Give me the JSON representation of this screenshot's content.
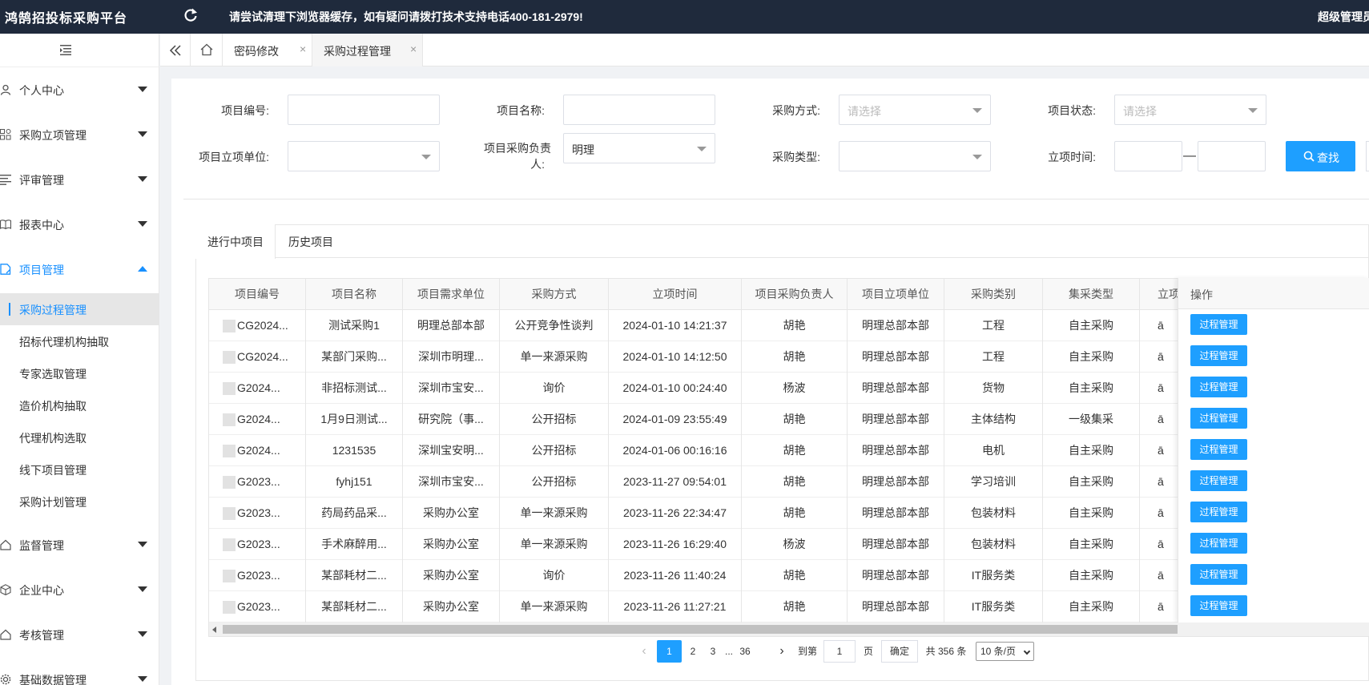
{
  "header": {
    "logo": "鸿鹄招投标采购平台",
    "notice": "请尝试清理下浏览器缓存，如有疑问请拨打技术支持电话400-181-2979!",
    "user": "超级管理员"
  },
  "sidebar": {
    "groups": [
      {
        "label": "个人中心",
        "icon": "user-icon"
      },
      {
        "label": "采购立项管理",
        "icon": "grid-icon"
      },
      {
        "label": "评审管理",
        "icon": "list-icon"
      },
      {
        "label": "报表中心",
        "icon": "book-icon"
      },
      {
        "label": "项目管理",
        "icon": "file-icon",
        "open": true
      },
      {
        "label": "监督管理",
        "icon": "home-icon"
      },
      {
        "label": "企业中心",
        "icon": "cube-icon"
      },
      {
        "label": "考核管理",
        "icon": "home-icon"
      },
      {
        "label": "基础数据管理",
        "icon": "gear-icon"
      }
    ],
    "sub_items": [
      {
        "label": "采购过程管理",
        "active": true
      },
      {
        "label": "招标代理机构抽取"
      },
      {
        "label": "专家选取管理"
      },
      {
        "label": "造价机构抽取"
      },
      {
        "label": "代理机构选取"
      },
      {
        "label": "线下项目管理"
      },
      {
        "label": "采购计划管理"
      }
    ]
  },
  "tabs": [
    {
      "label": "密码修改",
      "close": "×"
    },
    {
      "label": "采购过程管理",
      "close": "×",
      "active": true
    }
  ],
  "filters": {
    "project_code_label": "项目编号:",
    "project_name_label": "项目名称:",
    "purchase_method_label": "采购方式:",
    "purchase_method_placeholder": "请选择",
    "project_status_label": "项目状态:",
    "project_status_placeholder": "请选择",
    "project_unit_label": "项目立项单位:",
    "manager_label_line1": "项目采购负责",
    "manager_label_line2": "人:",
    "manager_value": "明理",
    "purchase_type_label": "采购类型:",
    "date_label": "立项时间:",
    "date_dash": "—",
    "search_button": "查找"
  },
  "panel_tabs": [
    "进行中项目",
    "历史项目"
  ],
  "table": {
    "columns": [
      "项目编号",
      "项目名称",
      "项目需求单位",
      "采购方式",
      "立项时间",
      "项目采购负责人",
      "项目立项单位",
      "采购类别",
      "集采类型",
      "立项"
    ],
    "op_header": "操作",
    "op_button": "过程管理",
    "rows": [
      {
        "code": "CG2024...",
        "name": "测试采购1",
        "unit": "明理总部本部",
        "method": "公开竞争性谈判",
        "time": "2024-01-10 14:21:37",
        "manager": "胡艳",
        "org": "明理总部本部",
        "category": "工程",
        "collect": "自主采购",
        "status": "ā"
      },
      {
        "code": "CG2024...",
        "name": "某部门采购...",
        "unit": "深圳市明理...",
        "method": "单一来源采购",
        "time": "2024-01-10 14:12:50",
        "manager": "胡艳",
        "org": "明理总部本部",
        "category": "工程",
        "collect": "自主采购",
        "status": "ā"
      },
      {
        "code": "G2024...",
        "name": "非招标测试...",
        "unit": "深圳市宝安...",
        "method": "询价",
        "time": "2024-01-10 00:24:40",
        "manager": "杨波",
        "org": "明理总部本部",
        "category": "货物",
        "collect": "自主采购",
        "status": "ā"
      },
      {
        "code": "G2024...",
        "name": "1月9日测试...",
        "unit": "研究院（事...",
        "method": "公开招标",
        "time": "2024-01-09 23:55:49",
        "manager": "胡艳",
        "org": "明理总部本部",
        "category": "主体结构",
        "collect": "一级集采",
        "status": "ā"
      },
      {
        "code": "G2024...",
        "name": "1231535",
        "unit": "深圳宝安明...",
        "method": "公开招标",
        "time": "2024-01-06 00:16:16",
        "manager": "胡艳",
        "org": "明理总部本部",
        "category": "电机",
        "collect": "自主采购",
        "status": "ā"
      },
      {
        "code": "G2023...",
        "name": "fyhj151",
        "unit": "深圳市宝安...",
        "method": "公开招标",
        "time": "2023-11-27 09:54:01",
        "manager": "胡艳",
        "org": "明理总部本部",
        "category": "学习培训",
        "collect": "自主采购",
        "status": "ā"
      },
      {
        "code": "G2023...",
        "name": "药局药品采...",
        "unit": "采购办公室",
        "method": "单一来源采购",
        "time": "2023-11-26 22:34:47",
        "manager": "胡艳",
        "org": "明理总部本部",
        "category": "包装材料",
        "collect": "自主采购",
        "status": "ā"
      },
      {
        "code": "G2023...",
        "name": "手术麻醉用...",
        "unit": "采购办公室",
        "method": "单一来源采购",
        "time": "2023-11-26 16:29:40",
        "manager": "杨波",
        "org": "明理总部本部",
        "category": "包装材料",
        "collect": "自主采购",
        "status": "ā"
      },
      {
        "code": "G2023...",
        "name": "某部耗材二...",
        "unit": "采购办公室",
        "method": "询价",
        "time": "2023-11-26 11:40:24",
        "manager": "胡艳",
        "org": "明理总部本部",
        "category": "IT服务类",
        "collect": "自主采购",
        "status": "ā"
      },
      {
        "code": "G2023...",
        "name": "某部耗材二...",
        "unit": "采购办公室",
        "method": "单一来源采购",
        "time": "2023-11-26 11:27:21",
        "manager": "胡艳",
        "org": "明理总部本部",
        "category": "IT服务类",
        "collect": "自主采购",
        "status": "ā"
      }
    ]
  },
  "pagination": {
    "prev": "‹",
    "pages": [
      "1",
      "2",
      "3"
    ],
    "ellipsis": "...",
    "last": "36",
    "next": "›",
    "goto_label": "到第",
    "goto_value": "1",
    "page_unit": "页",
    "confirm": "确定",
    "total": "共 356 条",
    "page_size": "10 条/页"
  },
  "colors": {
    "accent": "#1890ff",
    "button": "#1e9fff",
    "topbar": "#1f2a3c"
  }
}
